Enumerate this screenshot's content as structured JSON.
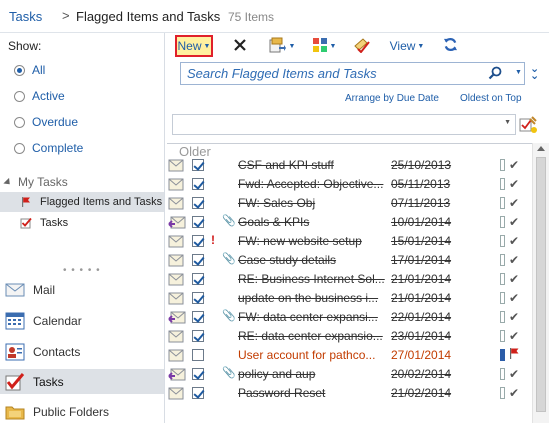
{
  "breadcrumb": {
    "root": "Tasks",
    "separator": ">",
    "folder": "Flagged Items and Tasks",
    "count": "75 Items"
  },
  "sidebar": {
    "show_label": "Show:",
    "filters": [
      {
        "label": "All",
        "selected": true
      },
      {
        "label": "Active",
        "selected": false
      },
      {
        "label": "Overdue",
        "selected": false
      },
      {
        "label": "Complete",
        "selected": false
      }
    ],
    "my_tasks_label": "My Tasks",
    "folders": [
      {
        "label": "Flagged Items and Tasks",
        "icon": "flag-icon",
        "selected": true
      },
      {
        "label": "Tasks",
        "icon": "tasks-icon",
        "selected": false
      }
    ],
    "nav": [
      {
        "label": "Mail",
        "icon": "mail-icon",
        "selected": false
      },
      {
        "label": "Calendar",
        "icon": "calendar-icon",
        "selected": false
      },
      {
        "label": "Contacts",
        "icon": "contacts-icon",
        "selected": false
      },
      {
        "label": "Tasks",
        "icon": "tasks-icon",
        "selected": true
      },
      {
        "label": "Public Folders",
        "icon": "public-folders-icon",
        "selected": false
      }
    ]
  },
  "toolbar": {
    "new_label": "New",
    "view_label": "View"
  },
  "search": {
    "placeholder": "Search Flagged Items and Tasks"
  },
  "arrange": {
    "by_label": "Arrange by Due Date",
    "order_label": "Oldest on Top"
  },
  "list": {
    "group_label": "Older",
    "rows": [
      {
        "subject": "CSF and KPI stuff",
        "due": "25/10/2013",
        "completed": true,
        "attachment": false,
        "important": false,
        "icon": "envelope-icon"
      },
      {
        "subject": "Fwd: Accepted: Objective...",
        "due": "05/11/2013",
        "completed": true,
        "attachment": false,
        "important": false,
        "icon": "envelope-icon"
      },
      {
        "subject": "FW: Sales Obj",
        "due": "07/11/2013",
        "completed": true,
        "attachment": false,
        "important": false,
        "icon": "envelope-icon"
      },
      {
        "subject": "Goals & KPIs",
        "due": "10/01/2014",
        "completed": true,
        "attachment": true,
        "important": false,
        "icon": "reply-envelope-icon"
      },
      {
        "subject": "FW: new website setup",
        "due": "15/01/2014",
        "completed": true,
        "attachment": false,
        "important": true,
        "icon": "envelope-icon"
      },
      {
        "subject": "Case study details",
        "due": "17/01/2014",
        "completed": true,
        "attachment": true,
        "important": false,
        "icon": "envelope-icon"
      },
      {
        "subject": "RE: Business Internet Sol...",
        "due": "21/01/2014",
        "completed": true,
        "attachment": false,
        "important": false,
        "icon": "envelope-icon"
      },
      {
        "subject": "update on the business i...",
        "due": "21/01/2014",
        "completed": true,
        "attachment": false,
        "important": false,
        "icon": "envelope-icon"
      },
      {
        "subject": "FW: data center expansi...",
        "due": "22/01/2014",
        "completed": true,
        "attachment": true,
        "important": false,
        "icon": "reply-envelope-icon"
      },
      {
        "subject": "RE: data center expansio...",
        "due": "23/01/2014",
        "completed": true,
        "attachment": false,
        "important": false,
        "icon": "envelope-icon"
      },
      {
        "subject": "User account for pathco...",
        "due": "27/01/2014",
        "completed": false,
        "attachment": false,
        "important": false,
        "icon": "envelope-icon"
      },
      {
        "subject": "policy and aup",
        "due": "20/02/2014",
        "completed": true,
        "attachment": true,
        "important": false,
        "icon": "reply-envelope-icon"
      },
      {
        "subject": "Password Reset",
        "due": "21/02/2014",
        "completed": true,
        "attachment": false,
        "important": false,
        "icon": "envelope-icon"
      }
    ]
  },
  "colors": {
    "link_blue": "#1f5ea8",
    "new_button_fill": "#fff0a0",
    "new_button_border": "#e0202a",
    "overdue_text": "#c23c00"
  }
}
